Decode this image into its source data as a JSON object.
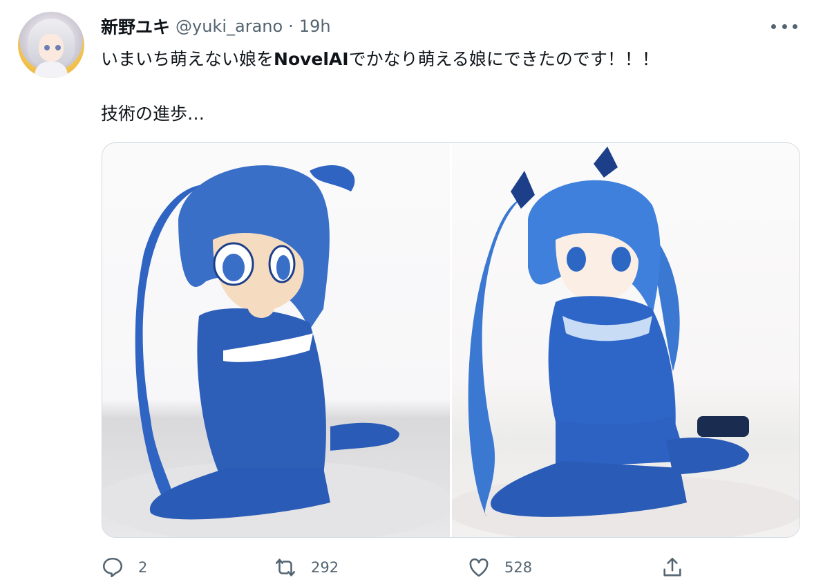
{
  "tweet": {
    "display_name": "新野ユキ",
    "handle": "@yuki_arano",
    "separator": "·",
    "time": "19h",
    "text_line1_before": "いまいち萌えない娘を",
    "text_line1_bold": "NovelAI",
    "text_line1_after": "でかなり萌える娘にできたのです！！！",
    "text_line2": "技術の進歩…"
  },
  "media": {
    "images": [
      {
        "subject": "blue-twin-tail-girl-before"
      },
      {
        "subject": "blue-twin-tail-girl-after"
      }
    ],
    "colors": {
      "hair": "#3a6fc8",
      "uniform": "#2e5fb8",
      "dark": "#1d3f8a"
    }
  },
  "actions": {
    "reply_count": "2",
    "retweet_count": "292",
    "like_count": "528",
    "icons": [
      "reply-icon",
      "retweet-icon",
      "like-icon",
      "share-icon"
    ]
  },
  "colors": {
    "text": "#0f1419",
    "secondary": "#536471",
    "border": "#cfd9de"
  }
}
